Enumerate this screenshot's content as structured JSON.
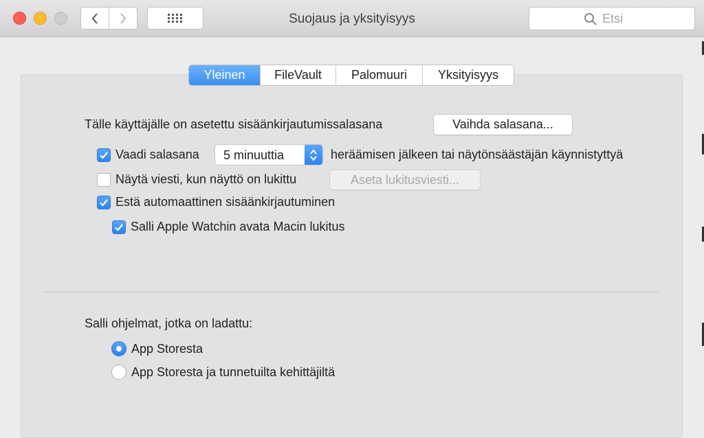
{
  "window": {
    "title": "Suojaus ja yksityisyys",
    "search_placeholder": "Etsi"
  },
  "tabs": [
    {
      "label": "Yleinen",
      "active": true
    },
    {
      "label": "FileVault",
      "active": false
    },
    {
      "label": "Palomuuri",
      "active": false
    },
    {
      "label": "Yksityisyys",
      "active": false
    }
  ],
  "general": {
    "password_text": "Tälle käyttäjälle on asetettu sisäänkirjautumissalasana",
    "change_password_button": "Vaihda salasana...",
    "require_password": {
      "label": "Vaadi salasana",
      "checked": true
    },
    "require_delay": "5 minuuttia",
    "require_suffix": "heräämisen jälkeen tai näytönsäästäjän käynnistyttyä",
    "show_message": {
      "label": "Näytä viesti, kun näyttö on lukittu",
      "checked": false
    },
    "set_message_button": "Aseta lukitusviesti...",
    "disable_autologin": {
      "label": "Estä automaattinen sisäänkirjautuminen",
      "checked": true
    },
    "apple_watch": {
      "label": "Salli Apple Watchin avata Macin lukitus",
      "checked": true
    }
  },
  "apps": {
    "heading": "Salli ohjelmat, jotka on ladattu:",
    "options": [
      {
        "label": "App Storesta",
        "selected": true
      },
      {
        "label": "App Storesta ja tunnetuilta kehittäjiltä",
        "selected": false
      }
    ]
  },
  "colors": {
    "accent": "#3b8ff3",
    "background": "#ececec"
  }
}
